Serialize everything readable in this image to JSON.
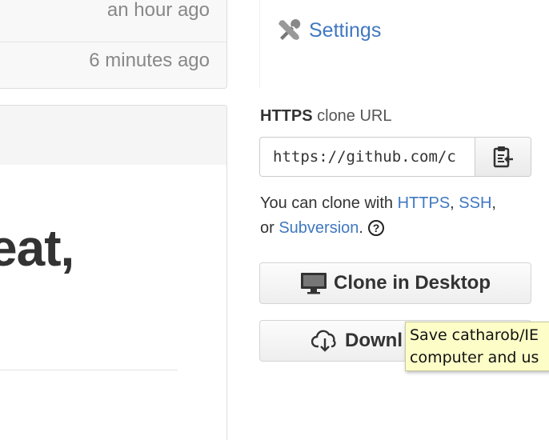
{
  "file_list": {
    "rows": [
      {
        "age": "an hour ago"
      },
      {
        "age": "6 minutes ago"
      }
    ]
  },
  "readme": {
    "heading_fragment": "eat,"
  },
  "sidebar": {
    "settings_label": "Settings",
    "settings_icon": "tools-icon"
  },
  "clone": {
    "protocol": "HTTPS",
    "label_rest": " clone URL",
    "url_value": "https://github.com/c",
    "copy_icon": "clipboard-icon",
    "help_prefix": "You can clone with ",
    "https_link": "HTTPS",
    "sep1": ", ",
    "ssh_link": "SSH",
    "sep2": ",",
    "or_text": "or ",
    "subversion_link": "Subversion",
    "period": "."
  },
  "buttons": {
    "clone_desktop": "Clone in Desktop",
    "download": "Downl"
  },
  "tooltip": {
    "line1": "Save catharob/IE",
    "line2": "computer and us"
  },
  "colors": {
    "link": "#4078c0",
    "tooltip_bg": "#fdfdc8"
  }
}
